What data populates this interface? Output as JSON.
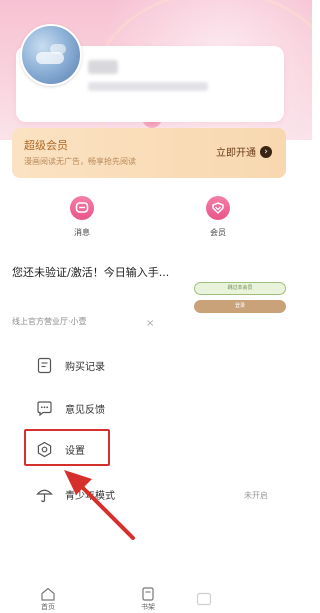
{
  "vip": {
    "title": "超级会员",
    "subtitle": "漫画阅读无广告，畅享抢先阅读",
    "action": "立即开通"
  },
  "quick_links": [
    {
      "label": "消息",
      "icon": "message-icon"
    },
    {
      "label": "会员",
      "icon": "vip-icon"
    }
  ],
  "notice": {
    "text": "您还未验证/激活！今日输入手...",
    "pill_1": "跳过本会员",
    "pill_2": "登录"
  },
  "official_text": "线上官方营业厅·小壹",
  "close_symbol": "×",
  "menu": [
    {
      "label": "购买记录",
      "icon": "receipt-icon"
    },
    {
      "label": "意见反馈",
      "icon": "feedback-icon"
    },
    {
      "label": "设置",
      "icon": "settings-icon"
    },
    {
      "label": "青少年模式",
      "icon": "umbrella-icon",
      "status": "未开启"
    }
  ],
  "tabbar": {
    "items": [
      {
        "label": "首页",
        "icon": "home-icon"
      },
      {
        "label": "书架",
        "icon": "bookshelf-icon"
      }
    ]
  },
  "colors": {
    "accent_pink": "#e9558a",
    "vip_gold": "#f8d8b0",
    "highlight_red": "#d6302c"
  }
}
